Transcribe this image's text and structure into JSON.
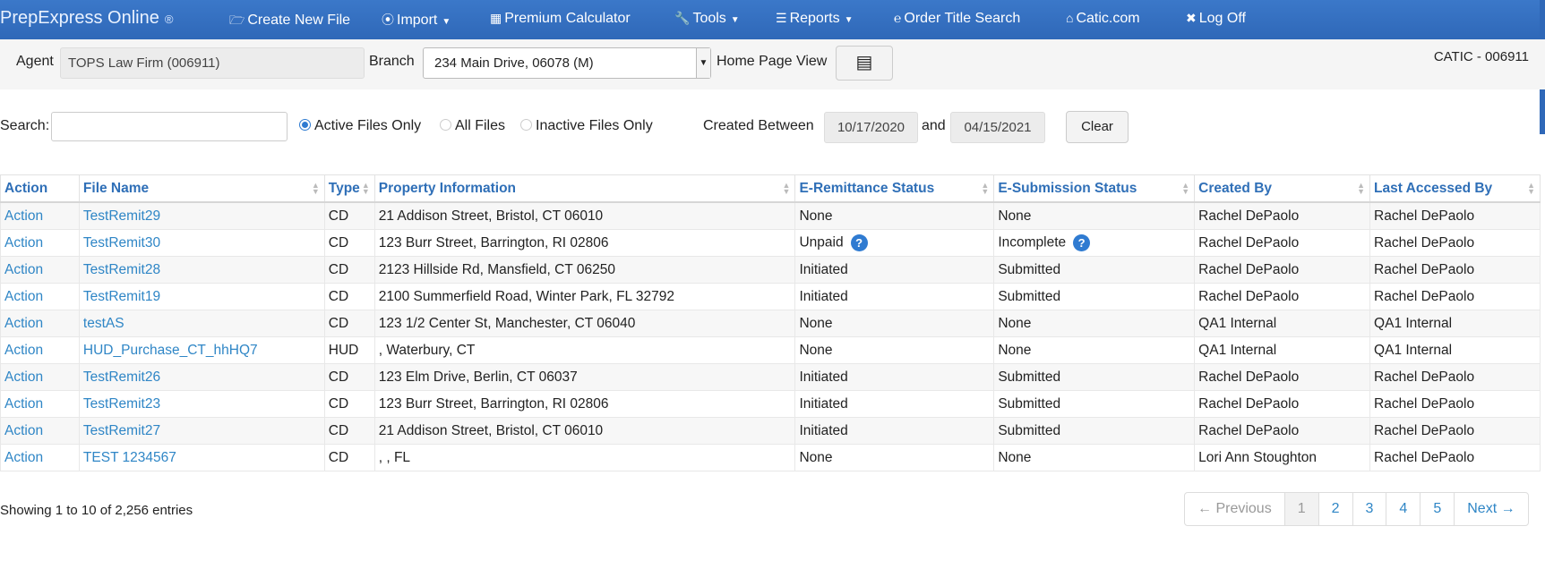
{
  "nav": {
    "brand": "PrepExpress Online",
    "brand_mark": "®",
    "items": [
      {
        "label": "Create New File",
        "icon": "folder-icon"
      },
      {
        "label": "Import",
        "icon": "download-icon",
        "dropdown": true
      },
      {
        "label": "Premium Calculator",
        "icon": "calculator-icon"
      },
      {
        "label": "Tools",
        "icon": "wrench-icon",
        "dropdown": true
      },
      {
        "label": "Reports",
        "icon": "list-icon",
        "dropdown": true
      },
      {
        "label": "Order Title Search",
        "icon": "text-cursor-icon"
      },
      {
        "label": "Catic.com",
        "icon": "home-icon"
      },
      {
        "label": "Log Off",
        "icon": "close-icon"
      }
    ]
  },
  "agentbar": {
    "agent_label": "Agent",
    "agent_value": "TOPS Law Firm (006911)",
    "branch_label": "Branch",
    "branch_value": "234 Main Drive, 06078 (M)",
    "home_view_label": "Home Page View",
    "catic_id": "CATIC - 006911"
  },
  "filters": {
    "search_label": "Search:",
    "search_value": "",
    "radio_options": [
      "Active Files Only",
      "All Files",
      "Inactive Files Only"
    ],
    "selected_radio": "Active Files Only",
    "created_between_label": "Created Between",
    "date_from": "10/17/2020",
    "and_label": "and",
    "date_to": "04/15/2021",
    "clear_label": "Clear"
  },
  "table": {
    "columns": [
      "Action",
      "File Name",
      "Type",
      "Property Information",
      "E-Remittance Status",
      "E-Submission Status",
      "Created By",
      "Last Accessed By"
    ],
    "rows": [
      [
        "Action",
        "TestRemit29",
        "CD",
        "21 Addison Street, Bristol, CT 06010",
        "None",
        "None",
        "Rachel DePaolo",
        "Rachel DePaolo"
      ],
      [
        "Action",
        "TestRemit30",
        "CD",
        "123 Burr Street, Barrington, RI 02806",
        "Unpaid",
        "Incomplete",
        "Rachel DePaolo",
        "Rachel DePaolo"
      ],
      [
        "Action",
        "TestRemit28",
        "CD",
        "2123 Hillside Rd, Mansfield, CT 06250",
        "Initiated",
        "Submitted",
        "Rachel DePaolo",
        "Rachel DePaolo"
      ],
      [
        "Action",
        "TestRemit19",
        "CD",
        "2100 Summerfield Road, Winter Park, FL 32792",
        "Initiated",
        "Submitted",
        "Rachel DePaolo",
        "Rachel DePaolo"
      ],
      [
        "Action",
        "testAS",
        "CD",
        "123 1/2 Center St, Manchester, CT 06040",
        "None",
        "None",
        "QA1 Internal",
        "QA1 Internal"
      ],
      [
        "Action",
        "HUD_Purchase_CT_hhHQ7",
        "HUD",
        ", Waterbury, CT",
        "None",
        "None",
        "QA1 Internal",
        "QA1 Internal"
      ],
      [
        "Action",
        "TestRemit26",
        "CD",
        "123 Elm Drive, Berlin, CT 06037",
        "Initiated",
        "Submitted",
        "Rachel DePaolo",
        "Rachel DePaolo"
      ],
      [
        "Action",
        "TestRemit23",
        "CD",
        "123 Burr Street, Barrington, RI 02806",
        "Initiated",
        "Submitted",
        "Rachel DePaolo",
        "Rachel DePaolo"
      ],
      [
        "Action",
        "TestRemit27",
        "CD",
        "21 Addison Street, Bristol, CT 06010",
        "Initiated",
        "Submitted",
        "Rachel DePaolo",
        "Rachel DePaolo"
      ],
      [
        "Action",
        "TEST 1234567",
        "CD",
        ", , FL",
        "None",
        "None",
        "Lori Ann Stoughton",
        "Rachel DePaolo"
      ]
    ],
    "help_icon_rows": [
      1
    ]
  },
  "footer": {
    "info": "Showing 1 to 10 of 2,256 entries",
    "pager": [
      "← Previous",
      "1",
      "2",
      "3",
      "4",
      "5",
      "Next →"
    ],
    "current_page": "1"
  },
  "colors": {
    "nav": "#2f68b8",
    "link": "#2f86c6",
    "header_text": "#2f6fb7",
    "help_badge": "#2f7bd1"
  }
}
